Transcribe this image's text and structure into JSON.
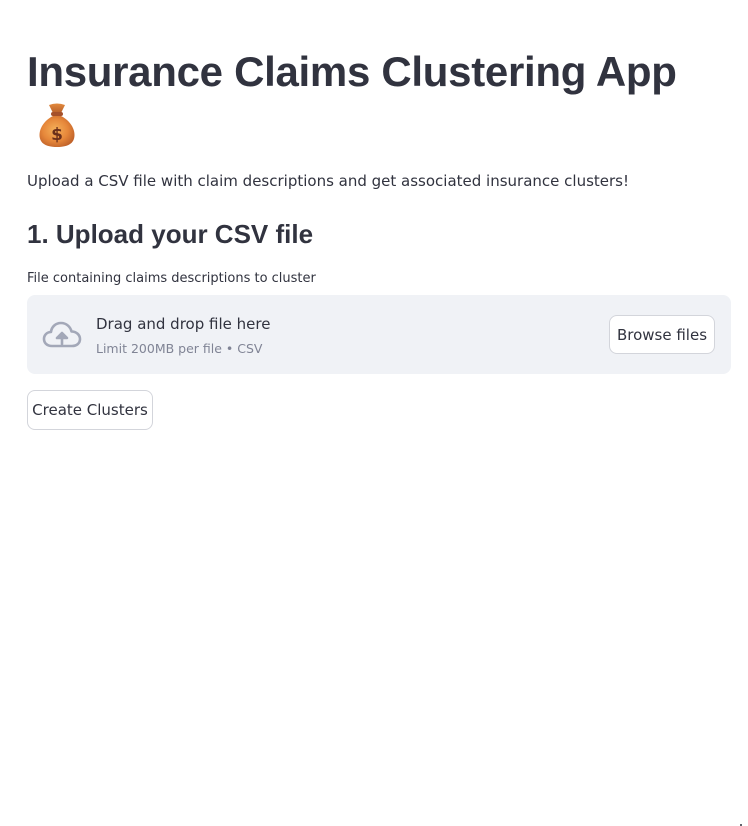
{
  "header": {
    "title": "Insurance Claims Clustering App",
    "emoji": "money-bag-icon",
    "description": "Upload a CSV file with claim descriptions and get associated insurance clusters!"
  },
  "upload_section": {
    "heading": "1. Upload your CSV file",
    "file_uploader": {
      "label": "File containing claims descriptions to cluster",
      "drop_text": "Drag and drop file here",
      "limit_text": "Limit 200MB per file • CSV",
      "browse_label": "Browse files",
      "icon": "cloud-upload-icon"
    }
  },
  "actions": {
    "create_clusters_label": "Create Clusters"
  },
  "colors": {
    "text": "#31333f",
    "muted_text": "#808495",
    "dropzone_bg": "#f0f2f6",
    "button_border": "#d3d5db",
    "icon": "#a3a8b8"
  }
}
